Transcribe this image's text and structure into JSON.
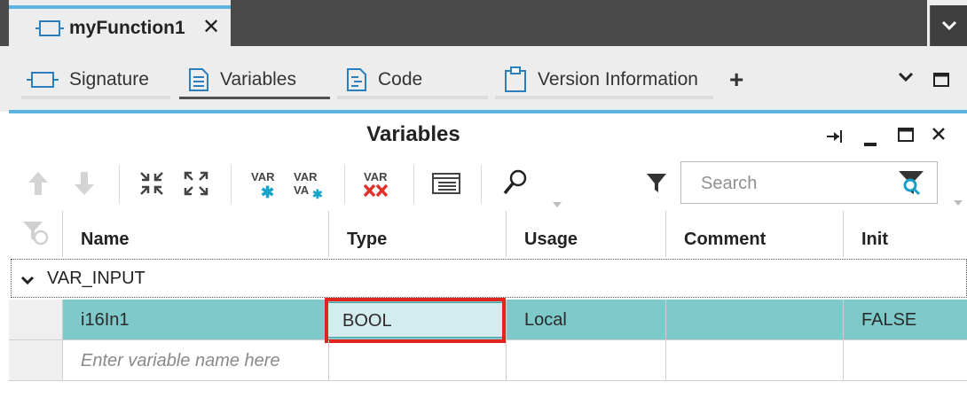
{
  "document_tab": {
    "title": "myFunction1",
    "close": "✕"
  },
  "view_tabs": [
    {
      "label": "Signature"
    },
    {
      "label": "Variables"
    },
    {
      "label": "Code"
    },
    {
      "label": "Version Information"
    }
  ],
  "view_tabs_add": "+",
  "panel": {
    "title": "Variables"
  },
  "search": {
    "placeholder": "Search"
  },
  "columns": {
    "name": "Name",
    "type": "Type",
    "usage": "Usage",
    "comment": "Comment",
    "init": "Init"
  },
  "group": {
    "label": "VAR_INPUT"
  },
  "rows": [
    {
      "name": "i16In1",
      "type": "BOOL",
      "usage": "Local",
      "comment": "",
      "init": "FALSE"
    }
  ],
  "new_row": {
    "name_placeholder": "Enter variable name here"
  },
  "toolbar_icons": {
    "var_insert": "VAR",
    "var_insert_multi": "VAR",
    "var_delete": "VAR"
  },
  "colors": {
    "accent_blue": "#5cb3dd",
    "selected_row": "#7ecaca",
    "highlight_red": "#e0251f",
    "dark_bar": "#4a4a4a"
  }
}
